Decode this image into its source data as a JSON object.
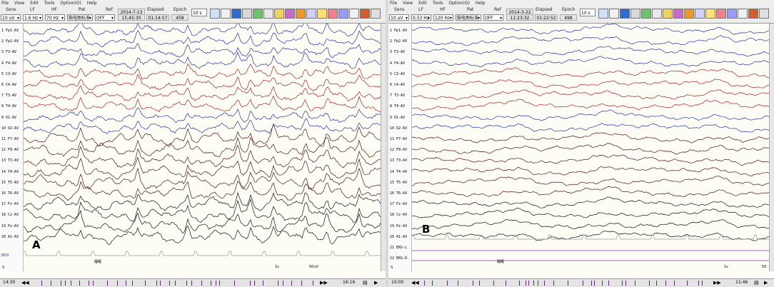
{
  "panels": [
    {
      "id": "A",
      "label": "A",
      "menu": [
        "File",
        "View",
        "Edit",
        "Tools",
        "Option(O)",
        "Help"
      ],
      "headers": [
        "Sens",
        "LF",
        "HF",
        "Pat",
        "Ref"
      ],
      "selects": [
        "10 uV",
        "1.6 Hz",
        "70 Hz",
        "脑电图标准",
        "OFF"
      ],
      "date": "2014-7-13",
      "time": "15:45:30",
      "elapsed_label": "Elapsed",
      "elapsed": "01:14:57",
      "epoch_label": "Epoch",
      "epoch": "458",
      "sens2": "10 s",
      "channels": [
        "1 Fp1-AV",
        "2 Fp2-AV",
        "3 F3-AV",
        "4 F4-AV",
        "5 C3-AV",
        "6 C4-AV",
        "7 T3-AV",
        "8 T4-AV",
        "9 O1-AV",
        "10 O2-AV",
        "11 F7-AV",
        "12 F8-AV",
        "13 T3-AV",
        "14 T4-AV",
        "15 T5-AV",
        "16 T6-AV",
        "17 Fz-AV",
        "18 Cz-AV",
        "19 Pz-AV",
        "20 A1-AV"
      ],
      "channel_colors": [
        "#2233aa",
        "#2233aa",
        "#2233aa",
        "#2233aa",
        "#aa2222",
        "#aa2222",
        "#aa2222",
        "#aa2222",
        "#2233aa",
        "#2233aa",
        "#551111",
        "#551111",
        "#551111",
        "#551111",
        "#551111",
        "#551111",
        "#111111",
        "#111111",
        "#111111",
        "#111111"
      ],
      "ekg_label": "EKG",
      "event_label": "睡眠",
      "time_start": "14:30",
      "time_end": "16:16",
      "scale_label": "1s",
      "amp_label": "50uV",
      "row_s": "S"
    },
    {
      "id": "B",
      "label": "B",
      "menu": [
        "File",
        "View",
        "Edit",
        "Tools",
        "Option(O)",
        "Help"
      ],
      "headers": [
        "Sens",
        "LF",
        "HF",
        "Pat",
        "Ref"
      ],
      "selects": [
        "10 uV",
        "0.53 Hz",
        "120 Hz",
        "脑电图标准",
        "OFF"
      ],
      "date": "2014-3-22",
      "time": "11:23:32",
      "elapsed_label": "Elapsed",
      "elapsed": "01:22:52",
      "epoch_label": "Epoch",
      "epoch": "498",
      "sens2": "10 s",
      "channels": [
        "1 Fp1-AV",
        "2 Fp2-AV",
        "3 F3-AV",
        "4 F4-AV",
        "5 C3-AV",
        "6 C4-AV",
        "7 T3-AV",
        "8 T4-AV",
        "9 O1-AV",
        "10 O2-AV",
        "11 F7-AV",
        "12 F8-AV",
        "13 T3-AV",
        "14 T4-AV",
        "15 T5-AV",
        "16 T6-AV",
        "17 Fz-AV",
        "18 Cz-AV",
        "19 Pz-AV",
        "20 A1-AV"
      ],
      "channel_colors": [
        "#2233aa",
        "#2233aa",
        "#2233aa",
        "#2233aa",
        "#aa2222",
        "#aa2222",
        "#aa2222",
        "#aa2222",
        "#2233aa",
        "#2233aa",
        "#551111",
        "#551111",
        "#551111",
        "#551111",
        "#551111",
        "#551111",
        "#111111",
        "#111111",
        "#111111",
        "#111111"
      ],
      "extra_channels": [
        "20 A1-AV",
        "21 EKG-L",
        "22 EKG-R"
      ],
      "ekg_label": "EKG",
      "event_label": "睡眠",
      "time_start": "10:00",
      "time_end": "11:46",
      "scale_label": "1s",
      "amp_label": "50",
      "row_s": "S"
    }
  ],
  "colors": {
    "blue_trace": "#2233aa",
    "red_trace": "#aa2222",
    "dark_red_trace": "#551111",
    "black_trace": "#111111",
    "ekg_trace": "#999999",
    "marker": "#662288"
  }
}
